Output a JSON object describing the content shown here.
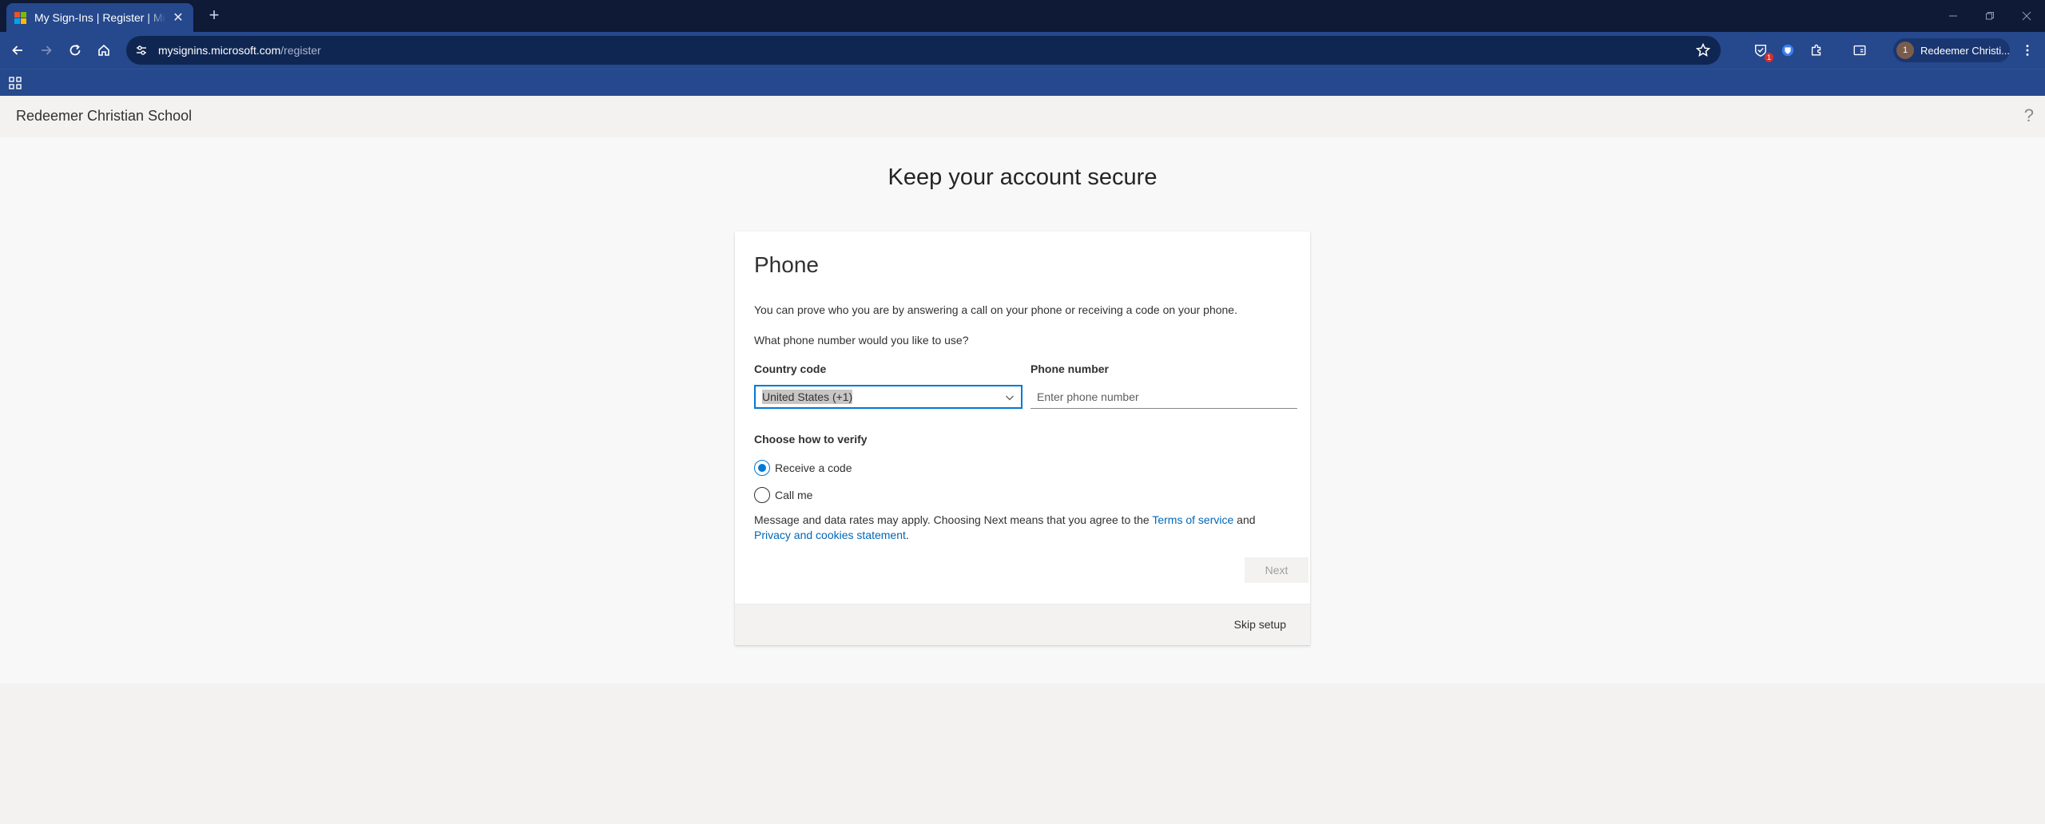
{
  "browser": {
    "tab_title": "My Sign-Ins | Register | Microsoft",
    "url_host": "mysignins.microsoft.com",
    "url_path": "/register",
    "profile_name": "Redeemer Christi...",
    "profile_initial": "1",
    "extension_badge": "1",
    "favicon_colors": [
      "#f25022",
      "#7fba00",
      "#00a4ef",
      "#ffb900"
    ],
    "theme_color": "#26488c"
  },
  "org": {
    "name": "Redeemer Christian School"
  },
  "page": {
    "title": "Keep your account secure"
  },
  "card": {
    "title": "Phone",
    "description": "You can prove who you are by answering a call on your phone or receiving a code on your phone.",
    "question": "What phone number would you like to use?",
    "country_code_label": "Country code",
    "country_code_value": "United States (+1)",
    "phone_number_label": "Phone number",
    "phone_number_placeholder": "Enter phone number",
    "phone_number_value": "",
    "verify_label": "Choose how to verify",
    "verify_options": [
      {
        "label": "Receive a code",
        "checked": true
      },
      {
        "label": "Call me",
        "checked": false
      }
    ],
    "legal_prefix": "Message and data rates may apply. Choosing Next means that you agree to the ",
    "terms_link": "Terms of service",
    "legal_and": " and ",
    "privacy_link": "Privacy and cookies statement",
    "legal_suffix": ".",
    "next_label": "Next",
    "skip_label": "Skip setup"
  },
  "colors": {
    "accent": "#0078d4",
    "link": "#0067b8"
  }
}
